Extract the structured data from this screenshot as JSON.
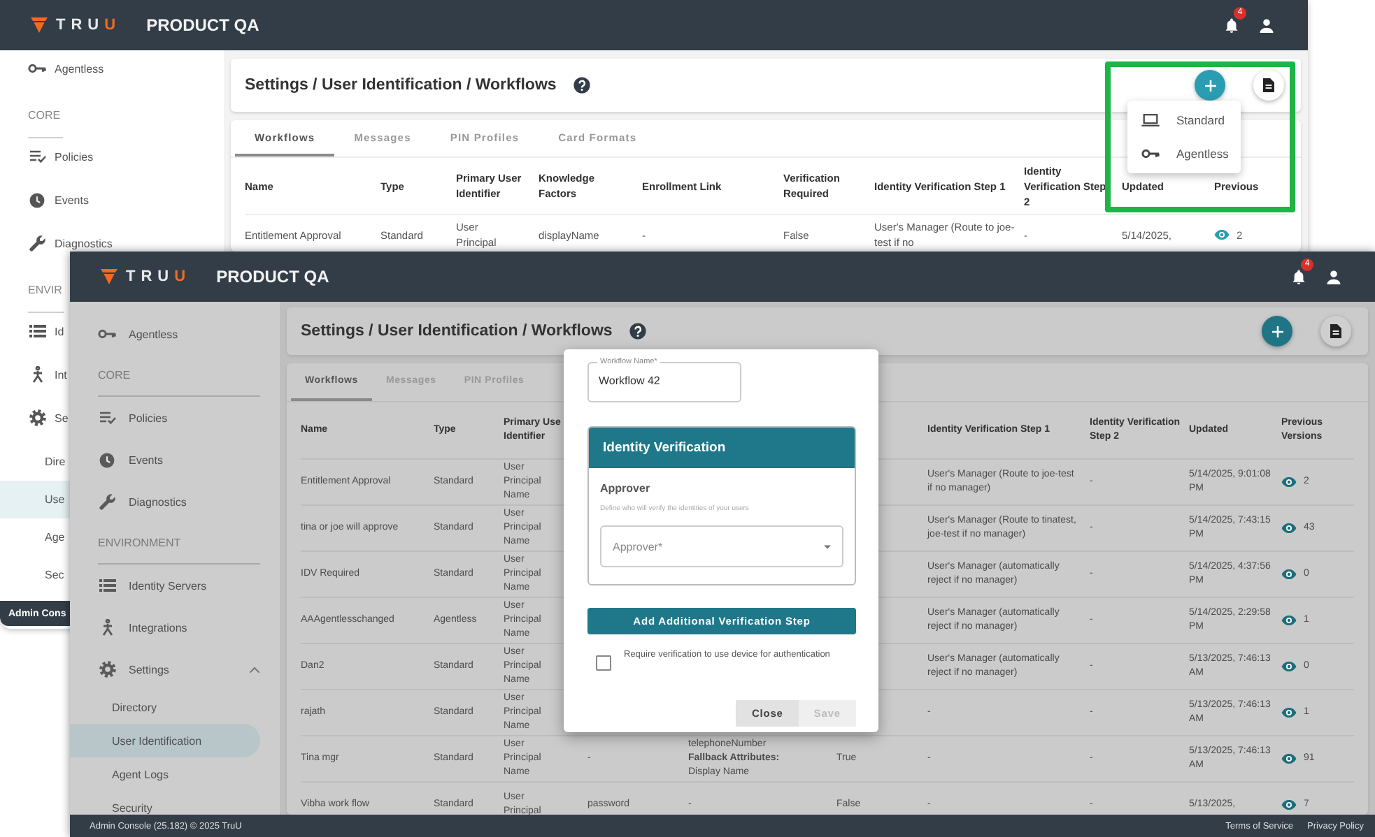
{
  "back_window": {
    "app_bar": {
      "brand": "TRUU",
      "product": "PRODUCT QA",
      "notification_count": "4"
    },
    "sidebar": {
      "items": [
        {
          "kind": "item",
          "label": "Agentless",
          "selected": false
        },
        {
          "kind": "section",
          "label": "CORE"
        },
        {
          "kind": "item",
          "label": "Policies",
          "selected": false
        },
        {
          "kind": "item",
          "label": "Events",
          "selected": false
        },
        {
          "kind": "item",
          "label": "Diagnostics",
          "selected": false
        },
        {
          "kind": "section",
          "label": "ENVIR"
        },
        {
          "kind": "item",
          "label": "Id",
          "selected": false
        },
        {
          "kind": "item",
          "label": "Int",
          "selected": false
        },
        {
          "kind": "item",
          "label": "Se",
          "selected": false
        },
        {
          "kind": "subitem",
          "label": "Dire",
          "selected": false
        },
        {
          "kind": "subitem",
          "label": "Use",
          "selected": true
        },
        {
          "kind": "subitem",
          "label": "Age",
          "selected": false
        },
        {
          "kind": "subitem",
          "label": "Sec",
          "selected": false
        }
      ],
      "footer": "Admin Cons"
    },
    "page_title": "Settings / User Identification / Workflows",
    "add_menu": {
      "items": [
        {
          "label": "Standard"
        },
        {
          "label": "Agentless"
        }
      ]
    },
    "tabs": [
      {
        "label": "Workflows",
        "selected": true
      },
      {
        "label": "Messages",
        "selected": false
      },
      {
        "label": "PIN Profiles",
        "selected": false
      },
      {
        "label": "Card Formats",
        "selected": false
      }
    ],
    "table": {
      "columns": {
        "name": "Name",
        "type": "Type",
        "primary_identifier": "Primary User Identifier",
        "knowledge_factors": "Knowledge Factors",
        "enrollment_link": "Enrollment Link",
        "verification_required": "Verification Required",
        "step_1": "Identity Verification Step 1",
        "step_2": "Identity Verification Step 2",
        "updated": "Updated",
        "previous_versions": "Previous"
      },
      "rows": [
        {
          "name": "Entitlement Approval",
          "type": "Standard",
          "primary_identifier": "User Principal",
          "knowledge_factors": "displayName",
          "enrollment_link": "-",
          "verification_required": "False",
          "step_1": "User's Manager (Route to joe-test if no",
          "step_2": "-",
          "updated": "5/14/2025,",
          "previous_versions": "2"
        }
      ]
    }
  },
  "front_window": {
    "app_bar": {
      "brand": "TRUU",
      "product": "PRODUCT QA",
      "notification_count": "4"
    },
    "sidebar": {
      "items": [
        {
          "kind": "item",
          "label": "Agentless",
          "selected": false
        },
        {
          "kind": "section",
          "label": "CORE"
        },
        {
          "kind": "item",
          "label": "Policies",
          "selected": false
        },
        {
          "kind": "item",
          "label": "Events",
          "selected": false
        },
        {
          "kind": "item",
          "label": "Diagnostics",
          "selected": false
        },
        {
          "kind": "section",
          "label": "ENVIRONMENT"
        },
        {
          "kind": "item",
          "label": "Identity Servers",
          "selected": false
        },
        {
          "kind": "item",
          "label": "Integrations",
          "selected": false
        },
        {
          "kind": "group",
          "label": "Settings",
          "selected": false,
          "expanded": true
        },
        {
          "kind": "subitem",
          "label": "Directory",
          "selected": false
        },
        {
          "kind": "subitem",
          "label": "User Identification",
          "selected": true
        },
        {
          "kind": "subitem",
          "label": "Agent Logs",
          "selected": false
        },
        {
          "kind": "subitem",
          "label": "Security",
          "selected": false
        }
      ]
    },
    "page_title": "Settings / User Identification / Workflows",
    "tabs": [
      {
        "label": "Workflows",
        "selected": true
      },
      {
        "label": "Messages",
        "selected": false
      },
      {
        "label": "PIN Profiles",
        "selected": false
      }
    ],
    "table": {
      "columns": {
        "name": "Name",
        "type": "Type",
        "primary_identifier": "Primary Use Identifier",
        "step_1": "Identity Verification Step 1",
        "step_2": "Identity Verification Step 2",
        "updated": "Updated",
        "previous_versions": "Previous Versions"
      },
      "rows": [
        {
          "name": "Entitlement Approval",
          "type": "Standard",
          "primary_identifier": "User Principal Name",
          "step_1": "User's Manager (Route to joe-test if no manager)",
          "step_2": "-",
          "updated": "5/14/2025, 9:01:08 PM",
          "previous_versions": "2"
        },
        {
          "name": "tina or joe will approve",
          "type": "Standard",
          "primary_identifier": "User Principal Name",
          "step_1": "User's Manager (Route to tinatest, joe-test if no manager)",
          "step_2": "-",
          "updated": "5/14/2025, 7:43:15 PM",
          "previous_versions": "43"
        },
        {
          "name": "IDV Required",
          "type": "Standard",
          "primary_identifier": "User Principal Name",
          "step_1": "User's Manager (automatically reject if no manager)",
          "step_2": "-",
          "updated": "5/14/2025, 4:37:56 PM",
          "previous_versions": "0"
        },
        {
          "name": "AAAgentlesschanged",
          "type": "Agentless",
          "primary_identifier": "User Principal Name",
          "step_1": "User's Manager (automatically reject if no manager)",
          "step_2": "-",
          "updated": "5/14/2025, 2:29:58 PM",
          "previous_versions": "1"
        },
        {
          "name": "Dan2",
          "type": "Standard",
          "primary_identifier": "User Principal Name",
          "step_1": "User's Manager (automatically reject if no manager)",
          "step_2": "-",
          "updated": "5/13/2025, 7:46:13 AM",
          "previous_versions": "0"
        },
        {
          "name": "rajath",
          "type": "Standard",
          "primary_identifier": "User Principal Name",
          "step_1": "-",
          "step_2": "-",
          "updated": "5/13/2025, 7:46:13 AM",
          "previous_versions": "1"
        },
        {
          "name": "Tina mgr",
          "type": "Standard",
          "primary_identifier": "User Principal Name",
          "knowledge_factors": "-",
          "enrollment_link": "telephoneNumber **Fallback Attributes:** Display Name",
          "verification_required": "True",
          "step_1": "-",
          "step_2": "-",
          "updated": "5/13/2025, 7:46:13 AM",
          "previous_versions": "91"
        },
        {
          "name": "Vibha work flow",
          "type": "Standard",
          "primary_identifier": "User Principal",
          "knowledge_factors": "password",
          "enrollment_link": "-",
          "verification_required": "False",
          "step_1": "-",
          "step_2": "-",
          "updated": "5/13/2025,",
          "previous_versions": "7"
        }
      ]
    },
    "footer": {
      "text": "Admin Console (25.182) © 2025 TruU",
      "links": [
        "Terms of Service",
        "Privacy Policy"
      ]
    },
    "dialog": {
      "name_field": {
        "label": "Workflow Name*",
        "value": "Workflow 42"
      },
      "card": {
        "title": "Identity Verification",
        "section": "Approver",
        "hint": "Define who will verify the identities of your users",
        "select": {
          "placeholder": "Approver*"
        }
      },
      "add_step_button": "Add Additional Verification Step",
      "device_checkbox": {
        "label": "Require verification to use device for authentication",
        "checked": false
      },
      "buttons": [
        {
          "label": "Close",
          "disabled": false
        },
        {
          "label": "Save",
          "disabled": true
        }
      ]
    }
  }
}
